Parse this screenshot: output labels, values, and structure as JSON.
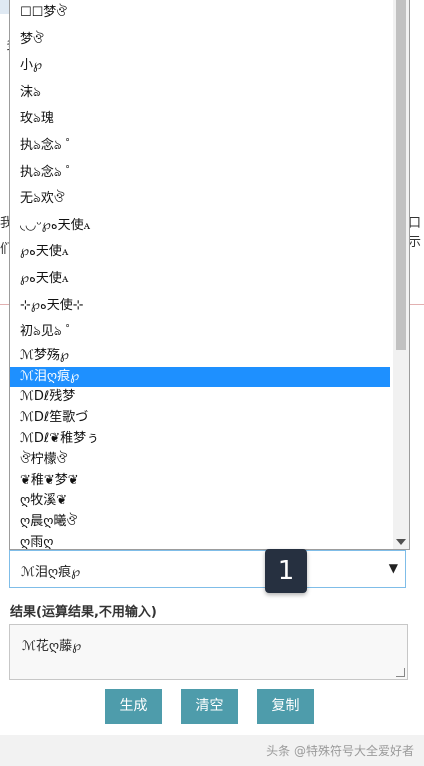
{
  "dropdown": {
    "options": [
      "☐☐梦ঔ",
      "梦ঔ",
      "小℘",
      "沫ঌ",
      "玫ঌ瑰",
      "执ঌ念ঌ ゜",
      "执ঌ念ঌ ゜",
      "无ঌ欢ঔ",
      "◟◡ᵕ℘ﻩ天使ꭺ",
      "℘ﻩ天使ꭺ",
      "℘ﻩ天使ꭺ",
      "⊹℘ﻩ天使⊹",
      "初ঌ见ঌ ゜",
      "ℳ梦殇℘",
      "ℳ泪ღ痕℘",
      "ℳDℓ残梦",
      "ℳDℓ笙歌づ",
      "ℳDℓ❦稚梦ぅ",
      "ঔ柠檬ঔ",
      "❦稚❦梦❦",
      "ღ牧溪❦",
      "ღ晨ღ曦ঔ",
      "ღ雨ღ"
    ],
    "selected_index": 14
  },
  "select": {
    "value": "ℳ泪ღ痕℘",
    "caret": "▼"
  },
  "badge": "1",
  "result": {
    "label": "结果(运算结果,不用输入)",
    "value": "ℳ花ღ藤℘"
  },
  "buttons": {
    "generate": "生成",
    "clear": "清空",
    "copy": "复制"
  },
  "watermark": "头条 @特殊符号大全爱好者",
  "background_fragments": {
    "left_top": "多",
    "left_mid_1": "我",
    "left_mid_2": "们",
    "right_mid": "口示"
  },
  "colors": {
    "selected": "#1e90ff",
    "button": "#4e9cab",
    "badge": "#263040"
  }
}
